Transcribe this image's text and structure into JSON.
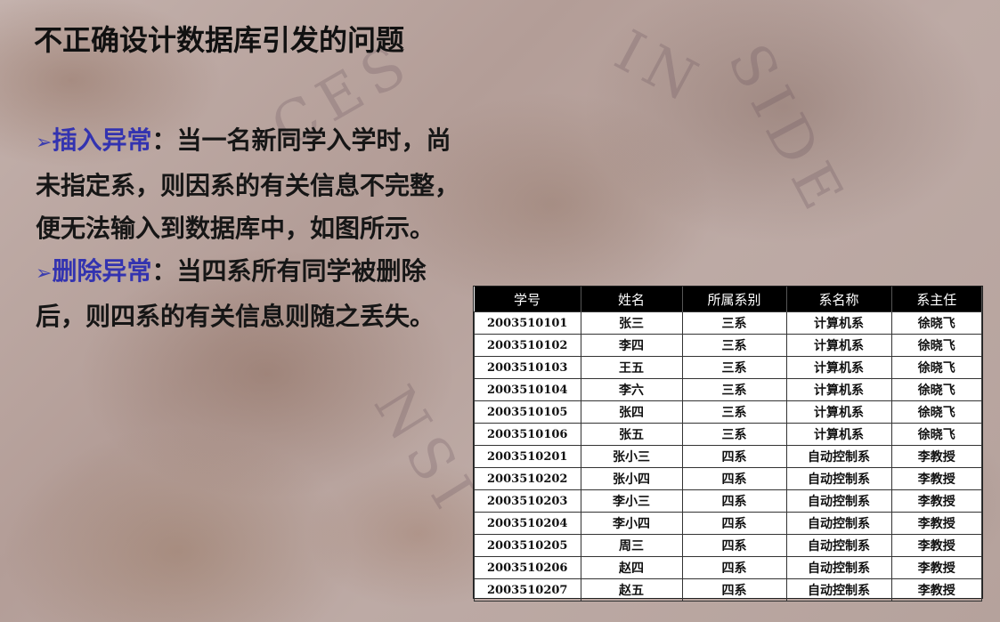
{
  "slide": {
    "title": "不正确设计数据库引发的问题",
    "bullets": [
      {
        "label": "插入异常",
        "text": "：当一名新同学入学时，尚未指定系，则因系的有关信息不完整，便无法输入到数据库中，如图所示。"
      },
      {
        "label": "删除异常",
        "text": "：当四系所有同学被删除后，则四系的有关信息则随之丢失。"
      }
    ],
    "bullet_symbol": "➢",
    "label_color": "#3333b0"
  },
  "watermark": [
    "IN",
    "SIDE",
    "CES",
    "NSI"
  ],
  "table": {
    "headers": [
      "学号",
      "姓名",
      "所属系别",
      "系名称",
      "系主任"
    ],
    "rows": [
      [
        "2003510101",
        "张三",
        "三系",
        "计算机系",
        "徐晓飞"
      ],
      [
        "2003510102",
        "李四",
        "三系",
        "计算机系",
        "徐晓飞"
      ],
      [
        "2003510103",
        "王五",
        "三系",
        "计算机系",
        "徐晓飞"
      ],
      [
        "2003510104",
        "李六",
        "三系",
        "计算机系",
        "徐晓飞"
      ],
      [
        "2003510105",
        "张四",
        "三系",
        "计算机系",
        "徐晓飞"
      ],
      [
        "2003510106",
        "张五",
        "三系",
        "计算机系",
        "徐晓飞"
      ],
      [
        "2003510201",
        "张小三",
        "四系",
        "自动控制系",
        "李教授"
      ],
      [
        "2003510202",
        "张小四",
        "四系",
        "自动控制系",
        "李教授"
      ],
      [
        "2003510203",
        "李小三",
        "四系",
        "自动控制系",
        "李教授"
      ],
      [
        "2003510204",
        "李小四",
        "四系",
        "自动控制系",
        "李教授"
      ],
      [
        "2003510205",
        "周三",
        "四系",
        "自动控制系",
        "李教授"
      ],
      [
        "2003510206",
        "赵四",
        "四系",
        "自动控制系",
        "李教授"
      ],
      [
        "2003510207",
        "赵五",
        "四系",
        "自动控制系",
        "李教授"
      ]
    ]
  }
}
